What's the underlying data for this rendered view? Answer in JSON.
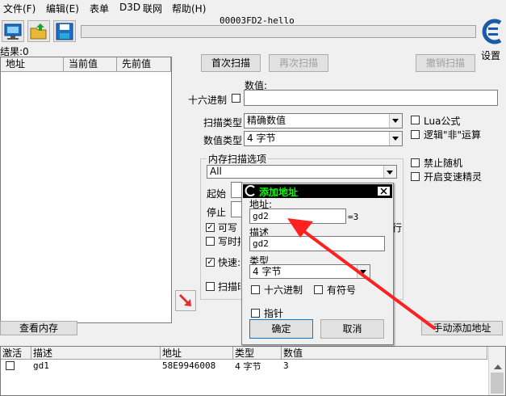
{
  "menu": [
    "文件(F)",
    "编辑(E)",
    "表单",
    "D3D",
    "联网",
    "帮助(H)"
  ],
  "process_title": "00003FD2-hello",
  "settings_label": "设置",
  "result_count": "结果:0",
  "results_columns": [
    "地址",
    "当前值",
    "先前值"
  ],
  "scan": {
    "first_scan": "首次扫描",
    "next_scan": "再次扫描",
    "undo_scan": "撤销扫描",
    "value_label": "数值:",
    "hex_label": "十六进制",
    "scan_type_label": "扫描类型",
    "scan_type_value": "精确数值",
    "value_type_label": "数值类型",
    "value_type_value": "4 字节",
    "lua_formula": "Lua公式",
    "logic_not": "逻辑\"非\"运算",
    "memory_options_title": "内存扫描选项",
    "memory_region": "All",
    "start_label": "起始",
    "stop_label": "停止",
    "writable": "可写",
    "copy_on_write": "写时拷",
    "fast_scan": "快速:",
    "pause_scan": "扫描时",
    "row_suffix": "行",
    "disable_random": "禁止随机",
    "enable_speedhack": "开启变速精灵"
  },
  "view_memory": "查看内存",
  "manual_add": "手动添加地址",
  "dialog": {
    "title": "添加地址",
    "address_label": "地址:",
    "address_value": "gd2",
    "address_result": "=3",
    "description_label": "描述",
    "description_value": "gd2",
    "type_label": "类型",
    "type_value": "4 字节",
    "hex": "十六进制",
    "signed": "有符号",
    "pointer": "指针",
    "ok": "确定",
    "cancel": "取消"
  },
  "cheat_columns": [
    "激活",
    "描述",
    "地址",
    "类型",
    "数值"
  ],
  "cheat_rows": [
    {
      "description": "gd1",
      "address": "58E9946008",
      "type": "4 字节",
      "value": "3"
    }
  ],
  "colors": {
    "arrow": "#ff2020",
    "dialog_title_bg": "#000000",
    "dialog_title_fg": "#00ff00"
  }
}
